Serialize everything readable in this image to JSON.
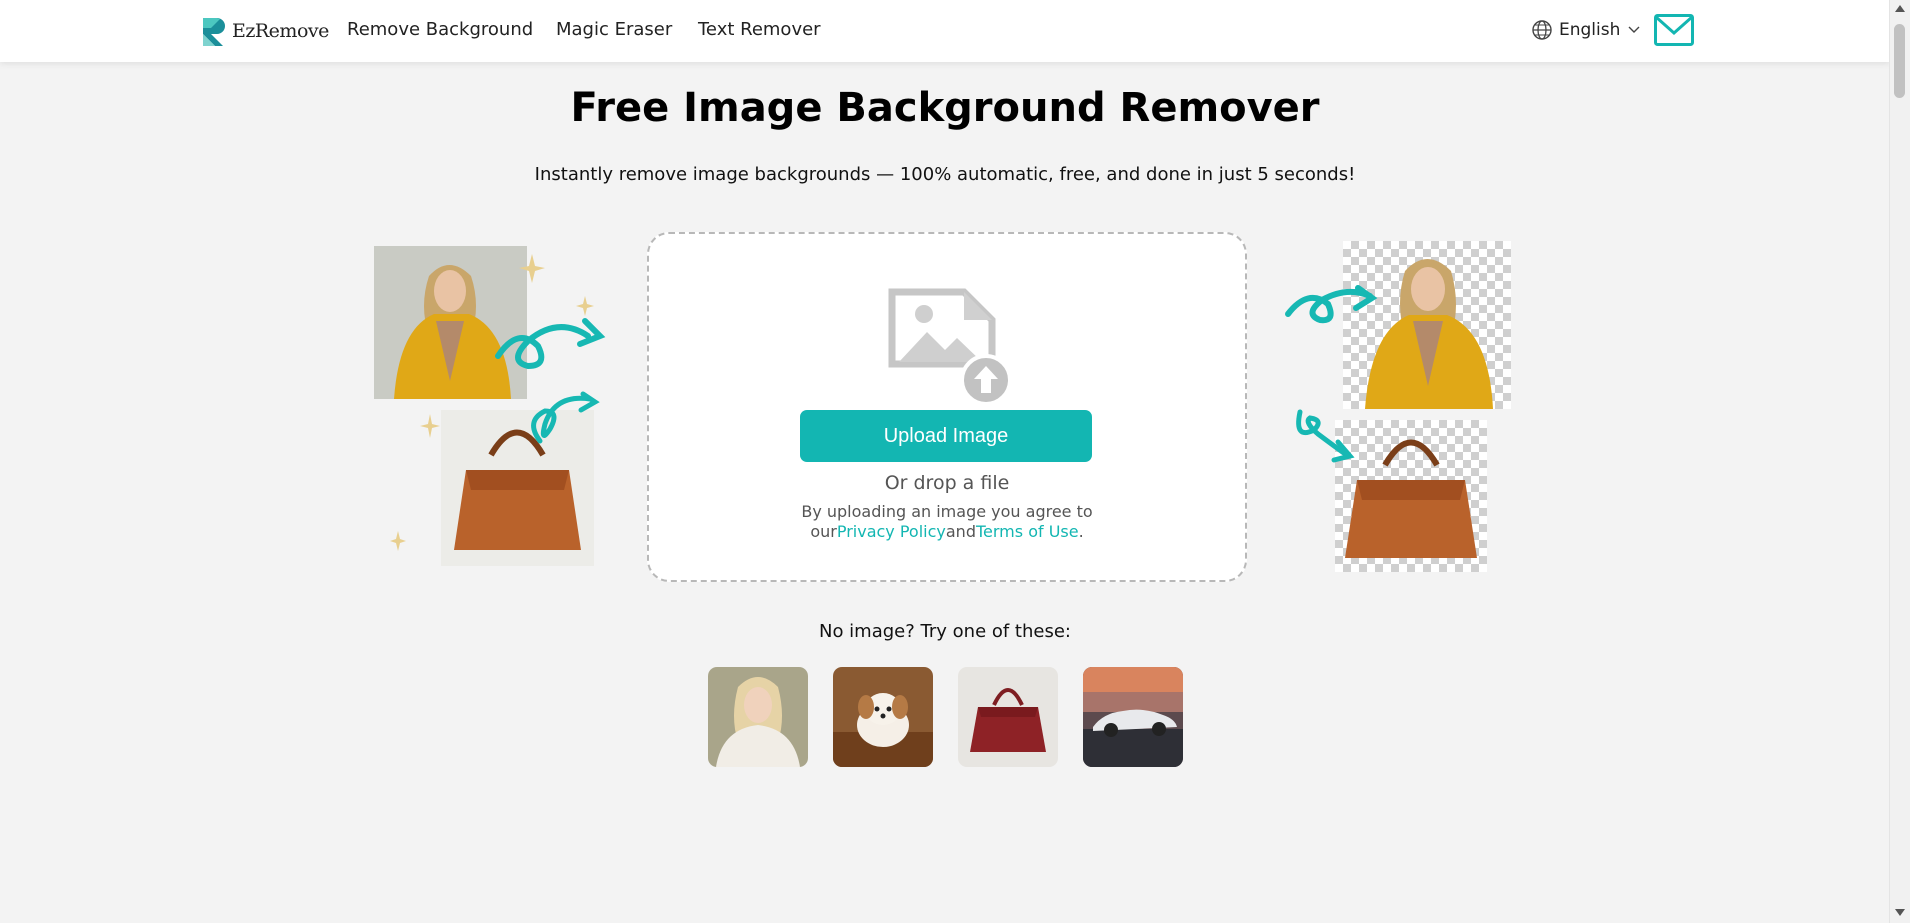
{
  "header": {
    "logo_text": "EzRemove",
    "nav": [
      "Remove Background",
      "Magic Eraser",
      "Text Remover"
    ],
    "language": "English"
  },
  "hero": {
    "title": "Free Image Background Remover",
    "subtitle": "Instantly remove image backgrounds — 100% automatic, free, and done in just 5 seconds!"
  },
  "upload": {
    "button_label": "Upload Image",
    "drop_text": "Or drop a file",
    "agree_line1": "By uploading an image you agree to",
    "agree_prefix": "our",
    "privacy_link": "Privacy Policy",
    "and_text": "and",
    "terms_link": "Terms of Use",
    "period": "."
  },
  "samples": {
    "label": "No image? Try one of these:"
  },
  "colors": {
    "accent": "#13b6b2",
    "page_bg": "#f3f3f3",
    "header_bg": "#ffffff"
  },
  "icons": [
    "logo-mark-icon",
    "globe-icon",
    "chevron-down-icon",
    "mail-icon",
    "image-upload-icon"
  ]
}
